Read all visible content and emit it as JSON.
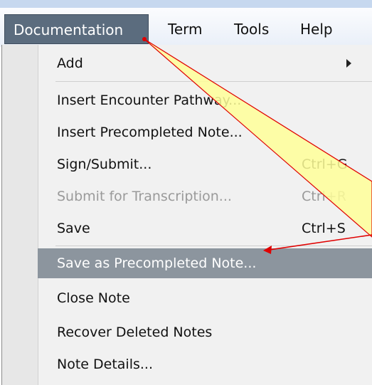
{
  "menubar": {
    "items": [
      "Documentation",
      "Term",
      "Tools",
      "Help"
    ],
    "active": "Documentation"
  },
  "dropdown": {
    "items": [
      {
        "label": "Add",
        "shortcut": "",
        "submenu": true
      },
      {
        "label": "Insert Encounter Pathway...",
        "shortcut": ""
      },
      {
        "label": "Insert Precompleted Note...",
        "shortcut": ""
      },
      {
        "label": "Sign/Submit...",
        "shortcut": "Ctrl+G"
      },
      {
        "label": "Submit for Transcription...",
        "shortcut": "Ctrl+R",
        "disabled": true
      },
      {
        "label": "Save",
        "shortcut": "Ctrl+S"
      },
      {
        "label": "Save as Precompleted Note...",
        "shortcut": "",
        "highlighted": true
      },
      {
        "label": "Close Note",
        "shortcut": ""
      },
      {
        "label": "Recover Deleted Notes",
        "shortcut": ""
      },
      {
        "label": "Note Details...",
        "shortcut": ""
      }
    ]
  },
  "colors": {
    "menu_active_bg": "#5b6c7e",
    "highlight_bg": "#8c959e",
    "callout_fill": "#ffff99",
    "annotation_red": "#e00000"
  }
}
